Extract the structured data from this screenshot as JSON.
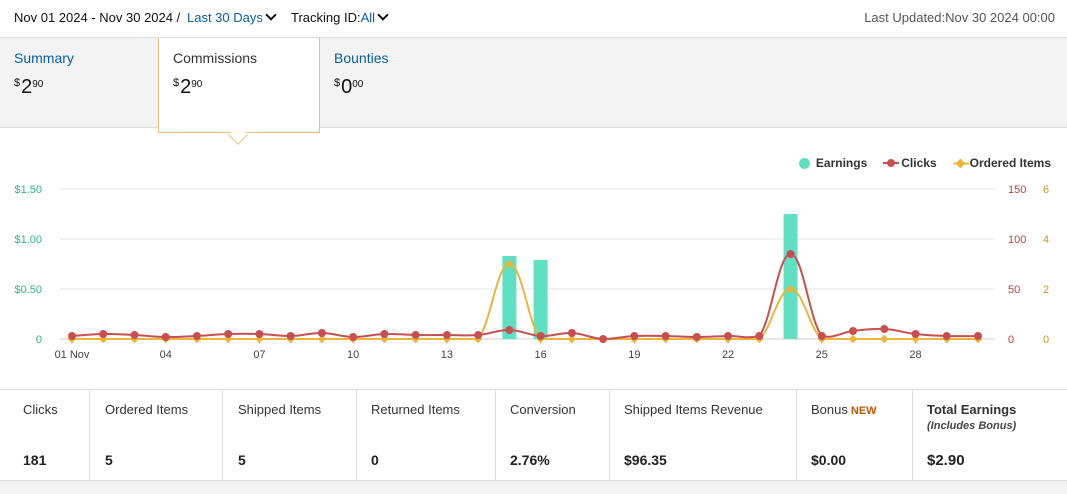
{
  "filters": {
    "date_range": "Nov 01 2024 - Nov 30 2024 /",
    "range_link": "Last 30 Days",
    "tracking_label": "Tracking ID:",
    "tracking_value": "All",
    "last_updated": "Last Updated:Nov 30 2024 00:00"
  },
  "tabs": [
    {
      "label": "Summary",
      "currency": "$",
      "whole": "2",
      "cents": "90"
    },
    {
      "label": "Commissions",
      "currency": "$",
      "whole": "2",
      "cents": "90"
    },
    {
      "label": "Bounties",
      "currency": "$",
      "whole": "0",
      "cents": "00"
    }
  ],
  "legend": {
    "earnings": "Earnings",
    "clicks": "Clicks",
    "ordered": "Ordered Items"
  },
  "colors": {
    "earnings": "#5fe0c4",
    "clicks": "#c7504e",
    "ordered": "#e9b63b",
    "link": "#0b5fa5"
  },
  "chart_data": {
    "type": "bar",
    "x": [
      1,
      2,
      3,
      4,
      5,
      6,
      7,
      8,
      9,
      10,
      11,
      12,
      13,
      14,
      15,
      16,
      17,
      18,
      19,
      20,
      21,
      22,
      23,
      24,
      25,
      26,
      27,
      28,
      29,
      30
    ],
    "x_tick_labels": [
      {
        "day": 1,
        "label": "01 Nov"
      },
      {
        "day": 4,
        "label": "04"
      },
      {
        "day": 7,
        "label": "07"
      },
      {
        "day": 10,
        "label": "10"
      },
      {
        "day": 13,
        "label": "13"
      },
      {
        "day": 16,
        "label": "16"
      },
      {
        "day": 19,
        "label": "19"
      },
      {
        "day": 22,
        "label": "22"
      },
      {
        "day": 25,
        "label": "25"
      },
      {
        "day": 28,
        "label": "28"
      }
    ],
    "y_left_ticks": [
      "0",
      "$0.50",
      "$1.00",
      "$1.50"
    ],
    "y_left_range": [
      0,
      1.5
    ],
    "y_mid_ticks": [
      "0",
      "50",
      "100",
      "150"
    ],
    "y_mid_range": [
      0,
      150
    ],
    "y_right_ticks": [
      "0",
      "2",
      "4",
      "6"
    ],
    "y_right_range": [
      0,
      6
    ],
    "grid": true,
    "legend_position": "top-right",
    "series": [
      {
        "name": "Earnings",
        "type": "bar",
        "axis": "left",
        "values": [
          0,
          0,
          0,
          0,
          0,
          0,
          0,
          0,
          0,
          0,
          0,
          0,
          0,
          0,
          0.83,
          0.79,
          0,
          0,
          0,
          0,
          0,
          0,
          0,
          1.25,
          0,
          0,
          0,
          0,
          0,
          0
        ]
      },
      {
        "name": "Clicks",
        "type": "line",
        "axis": "mid",
        "values": [
          3,
          5,
          4,
          2,
          3,
          5,
          5,
          3,
          6,
          2,
          5,
          4,
          4,
          4,
          9,
          3,
          6,
          0,
          3,
          3,
          2,
          3,
          3,
          85,
          3,
          8,
          10,
          5,
          3,
          3
        ]
      },
      {
        "name": "Ordered Items",
        "type": "line",
        "axis": "right",
        "values": [
          0,
          0,
          0,
          0,
          0,
          0,
          0,
          0,
          0,
          0,
          0,
          0,
          0,
          0,
          3,
          0,
          0,
          0,
          0,
          0,
          0,
          0,
          0,
          2,
          0,
          0,
          0,
          0,
          0,
          0
        ]
      }
    ]
  },
  "metrics": [
    {
      "label": "Clicks",
      "value": "181"
    },
    {
      "label": "Ordered Items",
      "value": "5"
    },
    {
      "label": "Shipped Items",
      "value": "5"
    },
    {
      "label": "Returned Items",
      "value": "0"
    },
    {
      "label": "Conversion",
      "value": "2.76%"
    },
    {
      "label": "Shipped Items Revenue",
      "value": "$96.35"
    },
    {
      "label": "Bonus",
      "badge": "NEW",
      "value": "$0.00"
    },
    {
      "label": "Total Earnings",
      "sub": "(Includes Bonus)",
      "value": "$2.90"
    }
  ]
}
